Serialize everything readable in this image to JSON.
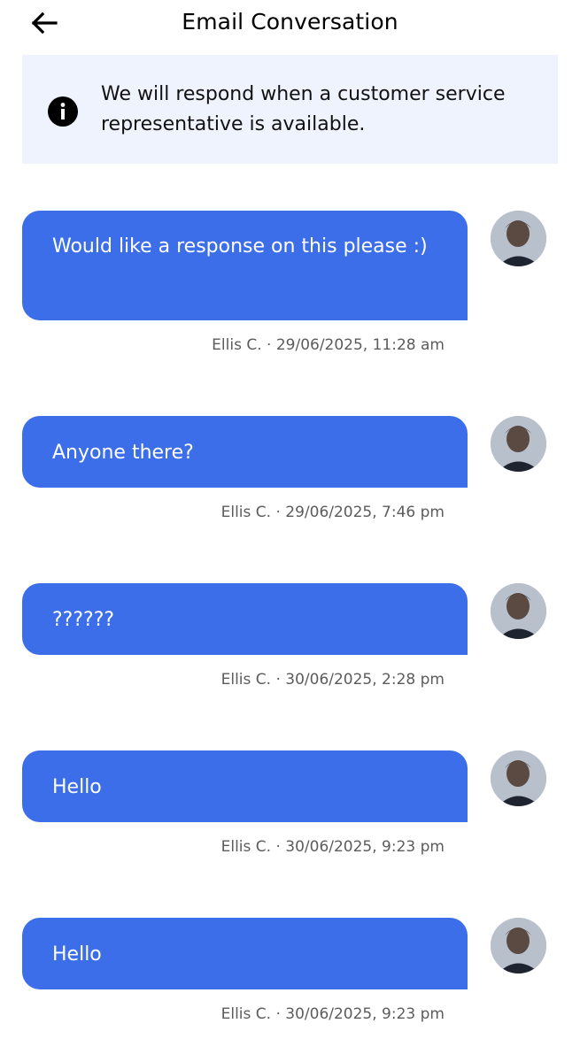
{
  "header": {
    "title": "Email Conversation"
  },
  "banner": {
    "text": "We will respond when a customer service representative is available."
  },
  "messages": [
    {
      "text": "Would like a response on this please :)",
      "meta": "Ellis C. · 29/06/2025, 11:28 am"
    },
    {
      "text": "Anyone there?",
      "meta": "Ellis C. · 29/06/2025, 7:46 pm"
    },
    {
      "text": "??????",
      "meta": "Ellis C. · 30/06/2025, 2:28 pm"
    },
    {
      "text": "Hello",
      "meta": "Ellis C. · 30/06/2025, 9:23 pm"
    },
    {
      "text": "Hello",
      "meta": "Ellis C. · 30/06/2025, 9:23 pm"
    }
  ],
  "colors": {
    "bubble": "#3b6ee8",
    "banner": "#eef3fd",
    "meta_text": "#5c5c5c"
  },
  "icons": {
    "back": "arrow-left-icon",
    "info": "info-icon",
    "avatar": "user-avatar"
  }
}
